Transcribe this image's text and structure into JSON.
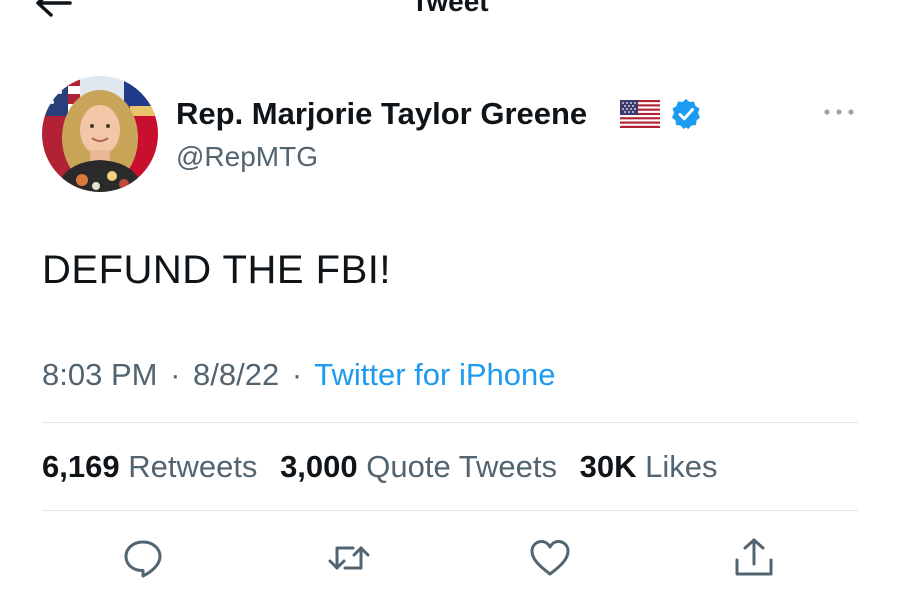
{
  "header": {
    "title": "Tweet",
    "back_icon": "back-arrow-icon"
  },
  "author": {
    "name": "Rep. Marjorie Taylor Greene",
    "flag": "us-flag-icon",
    "verified": "verified-badge-icon",
    "handle": "@RepMTG"
  },
  "tweet": {
    "text": "DEFUND THE FBI!",
    "time": "8:03 PM",
    "date": "8/8/22",
    "separator": "·",
    "source": "Twitter for iPhone"
  },
  "stats": {
    "retweets": {
      "count": "6,169",
      "label": "Retweets"
    },
    "quotes": {
      "count": "3,000",
      "label": "Quote Tweets"
    },
    "likes": {
      "count": "30K",
      "label": "Likes"
    }
  },
  "actions": [
    "reply-icon",
    "retweet-icon",
    "like-icon",
    "share-icon"
  ],
  "colors": {
    "accent": "#1d9bf0",
    "secondary_text": "#536471",
    "primary_text": "#0f1419",
    "divider": "#e1e6ea"
  }
}
